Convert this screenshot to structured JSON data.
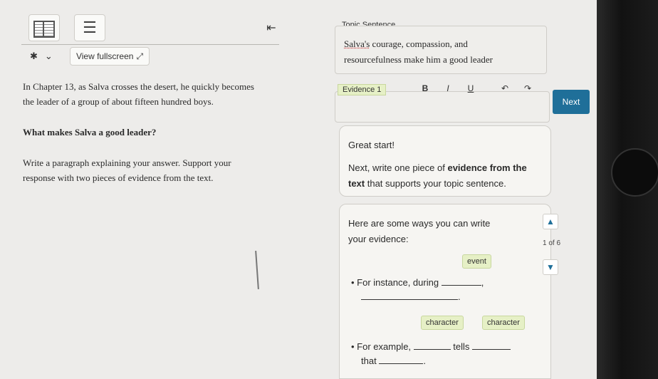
{
  "toolbar": {
    "view_fullscreen_label": "View fullscreen"
  },
  "prompt": {
    "context_line1": "In Chapter 13, as Salva crosses the desert, he quickly becomes",
    "context_line2": "the leader of a group of about fifteen hundred boys.",
    "question": "What makes Salva a good leader?",
    "instruction_line1": "Write a paragraph explaining your answer. Support your",
    "instruction_line2": "response with two pieces of evidence from the text."
  },
  "topic": {
    "label": "Topic Sentence",
    "text_name": "Salva's",
    "text_line1_rest": " courage, compassion, and",
    "text_line2": "resourcefulness make him a good leader"
  },
  "evidence": {
    "label": "Evidence 1",
    "bold": "B",
    "italic": "I",
    "underline": "U"
  },
  "next_button": "Next",
  "coach": {
    "greeting": "Great start!",
    "line1_pre": "Next, write one piece of ",
    "line1_bold": "evidence from the",
    "line2_bold": "text",
    "line2_rest": " that supports your topic sentence."
  },
  "ways": {
    "heading_line1": "Here are some ways you can write",
    "heading_line2": "your evidence:",
    "chip_event": "event",
    "bullet1": "For instance, during",
    "chip_character1": "character",
    "chip_character2": "character",
    "bullet2_a": "For example,",
    "bullet2_b": "tells",
    "bullet2_c": "that",
    "page_indicator": "1 of 6"
  },
  "colors": {
    "accent": "#1f6f99",
    "chip_bg": "#e6f0c6"
  }
}
